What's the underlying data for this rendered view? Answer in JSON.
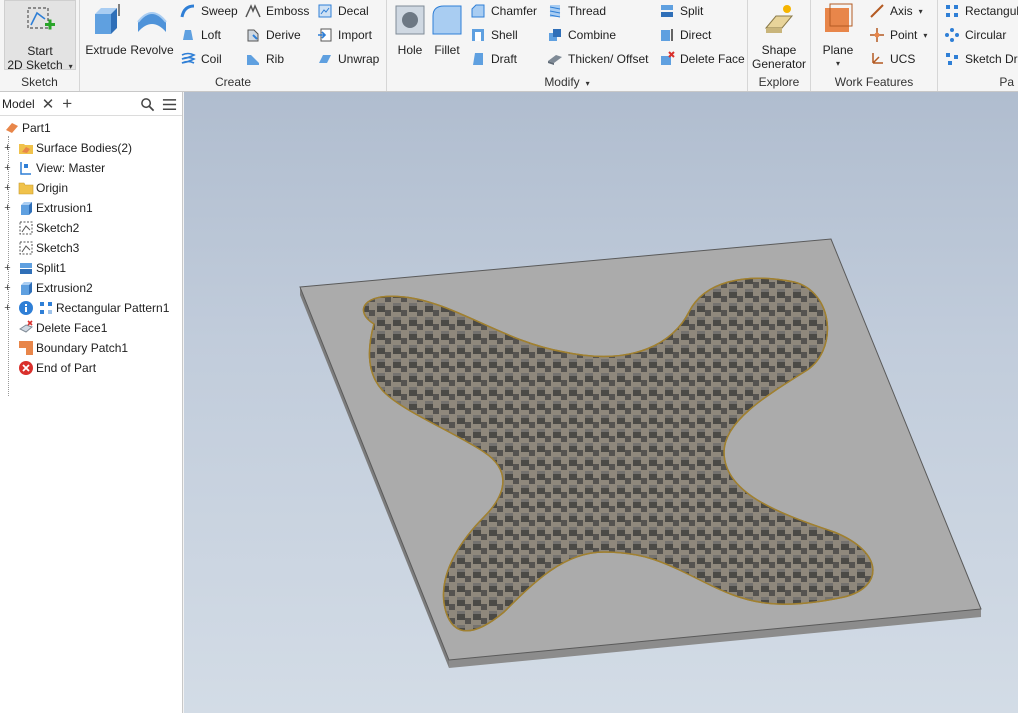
{
  "ribbon": {
    "sketch_panel": {
      "title": "Sketch",
      "start_sketch_line1": "Start",
      "start_sketch_line2": "2D Sketch"
    },
    "create_panel": {
      "title": "Create",
      "extrude": "Extrude",
      "revolve": "Revolve",
      "sweep": "Sweep",
      "emboss": "Emboss",
      "decal": "Decal",
      "loft": "Loft",
      "derive": "Derive",
      "import": "Import",
      "coil": "Coil",
      "rib": "Rib",
      "unwrap": "Unwrap"
    },
    "modify_panel": {
      "title": "Modify",
      "hole": "Hole",
      "fillet": "Fillet",
      "chamfer": "Chamfer",
      "thread": "Thread",
      "split": "Split",
      "shell": "Shell",
      "combine": "Combine",
      "direct": "Direct",
      "draft": "Draft",
      "thicken_offset": "Thicken/ Offset",
      "delete_face": "Delete Face"
    },
    "explore_panel": {
      "title": "Explore",
      "shape_generator_line1": "Shape",
      "shape_generator_line2": "Generator"
    },
    "work_features_panel": {
      "title": "Work Features",
      "plane": "Plane",
      "axis": "Axis",
      "point": "Point",
      "ucs": "UCS"
    },
    "pattern_panel": {
      "title": "Pa",
      "rectangular": "Rectangul",
      "circular": "Circular",
      "sketch_driven": "Sketch Dri"
    }
  },
  "browser": {
    "tab_label": "Model",
    "items": [
      {
        "label": "Part1"
      },
      {
        "label": "Surface Bodies(2)"
      },
      {
        "label": "View: Master"
      },
      {
        "label": "Origin"
      },
      {
        "label": "Extrusion1"
      },
      {
        "label": "Sketch2"
      },
      {
        "label": "Sketch3"
      },
      {
        "label": "Split1"
      },
      {
        "label": "Extrusion2"
      },
      {
        "label": "Rectangular Pattern1"
      },
      {
        "label": "Delete Face1"
      },
      {
        "label": "Boundary Patch1"
      },
      {
        "label": "End of Part"
      }
    ]
  },
  "colors": {
    "accent_blue": "#2f7fd6",
    "folder_yellow": "#f0c24b",
    "plate_gray": "#a9a9a9",
    "region_tan": "#b8a88a",
    "error_red": "#d9302c"
  }
}
